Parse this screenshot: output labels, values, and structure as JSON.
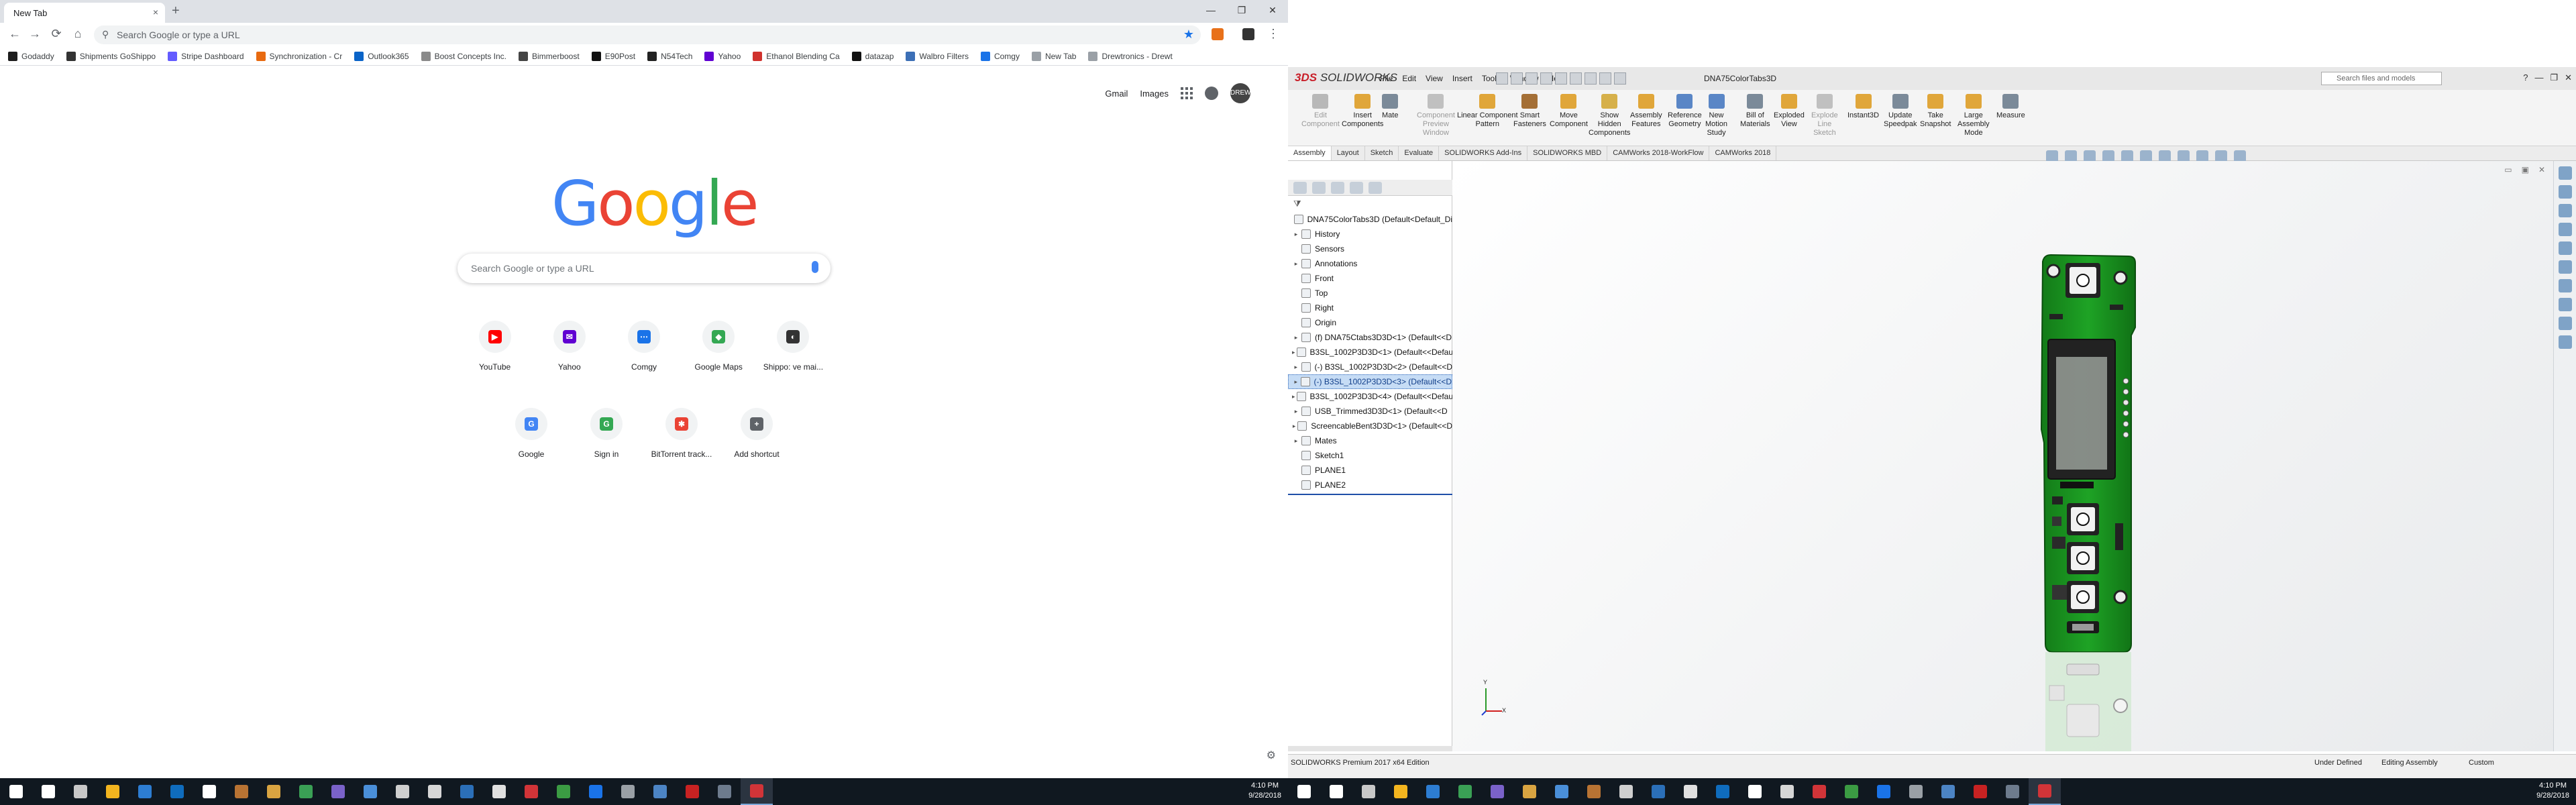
{
  "chrome": {
    "tab_title": "New Tab",
    "tab_close": "×",
    "new_tab": "+",
    "window_buttons": [
      "—",
      "❐",
      "✕"
    ],
    "nav": {
      "back": "←",
      "forward": "→",
      "reload": "⟳",
      "home": "⌂"
    },
    "omnibox_placeholder": "Search Google or type a URL",
    "bookmarks": [
      {
        "label": "Godaddy",
        "color": "#1d1d1d"
      },
      {
        "label": "Shipments GoShippo",
        "color": "#333333"
      },
      {
        "label": "Stripe Dashboard",
        "color": "#635bff"
      },
      {
        "label": "Synchronization - Cr",
        "color": "#e86a10"
      },
      {
        "label": "Outlook365",
        "color": "#0a64c8"
      },
      {
        "label": "Boost Concepts Inc.",
        "color": "#8a8a8a"
      },
      {
        "label": "Bimmerboost",
        "color": "#444444"
      },
      {
        "label": "E90Post",
        "color": "#111111"
      },
      {
        "label": "N54Tech",
        "color": "#222222"
      },
      {
        "label": "Yahoo",
        "color": "#6001d2"
      },
      {
        "label": "Ethanol Blending Ca",
        "color": "#d0312d"
      },
      {
        "label": "datazap",
        "color": "#111111"
      },
      {
        "label": "Walbro Filters",
        "color": "#3c6fb6"
      },
      {
        "label": "Comgy",
        "color": "#1a73e8"
      },
      {
        "label": "New Tab",
        "color": "#9aa0a6"
      },
      {
        "label": "Drewtronics - Drewt",
        "color": "#9aa0a6"
      }
    ],
    "header_links": {
      "gmail": "Gmail",
      "images": "Images",
      "avatar_text": "DREW"
    },
    "logo": "Google",
    "search_placeholder": "Search Google or type a URL",
    "shortcuts_row1": [
      {
        "label": "YouTube",
        "icon": "youtube-icon",
        "color": "#ff0000",
        "glyph": "▶"
      },
      {
        "label": "Yahoo",
        "icon": "yahoo-mail-icon",
        "color": "#6001d2",
        "glyph": "✉"
      },
      {
        "label": "Comgy",
        "icon": "comgy-icon",
        "color": "#1a73e8",
        "glyph": "⋯"
      },
      {
        "label": "Google Maps",
        "icon": "maps-icon",
        "color": "#34a853",
        "glyph": "◆"
      },
      {
        "label": "Shippo: ve mai...",
        "icon": "shippo-icon",
        "color": "#333333",
        "glyph": "◐"
      }
    ],
    "shortcuts_row2": [
      {
        "label": "Google",
        "icon": "google-icon",
        "color": "#4285f4",
        "glyph": "G"
      },
      {
        "label": "Sign in",
        "icon": "signin-icon",
        "color": "#34a853",
        "glyph": "G"
      },
      {
        "label": "BitTorrent track...",
        "icon": "bittorrent-icon",
        "color": "#ea4335",
        "glyph": "✱"
      },
      {
        "label": "Add shortcut",
        "icon": "add-icon",
        "color": "#5f6368",
        "glyph": "+"
      }
    ]
  },
  "taskbar_left": {
    "icon_colors": [
      "#ffffff",
      "#c8c8c8",
      "#f3b51f",
      "#2d7dd2",
      "#0f6cbd",
      "#ffffff",
      "#b87333",
      "#d9a441",
      "#3aa055",
      "#7a62c9",
      "#4a8fd9",
      "#cfcfcf",
      "#d6d6d6",
      "#2b6fb8",
      "#e0e0e0",
      "#d13438",
      "#3b9b43",
      "#1a73e8",
      "#9aa0a6",
      "#4c84c4",
      "#c82222",
      "#6d7b8d",
      "#d13438"
    ],
    "active_index": 22,
    "time": "4:10 PM",
    "date": "9/28/2018"
  },
  "solidworks": {
    "logo_ds": "3DS",
    "logo_text": "SOLIDWORKS",
    "menus": [
      "File",
      "Edit",
      "View",
      "Insert",
      "Tools",
      "Window",
      "Help"
    ],
    "doc_title": "DNA75ColorTabs3D",
    "search_placeholder": "Search files and models",
    "window_buttons": [
      "?",
      "—",
      "❐",
      "✕"
    ],
    "commands": [
      {
        "label": "Edit\nComponent",
        "enabled": false,
        "color": "#b8b8b8"
      },
      {
        "label": "Insert\nComponents",
        "enabled": true,
        "color": "#e0a63a"
      },
      {
        "label": "Mate",
        "enabled": true,
        "color": "#7b8a99"
      },
      {
        "label": "Component\nPreview\nWindow",
        "enabled": false,
        "color": "#c0c0c0"
      },
      {
        "label": "Linear Component\nPattern",
        "enabled": true,
        "color": "#e0a63a"
      },
      {
        "label": "Smart\nFasteners",
        "enabled": true,
        "color": "#a46f36"
      },
      {
        "label": "Move\nComponent",
        "enabled": true,
        "color": "#e0a63a"
      },
      {
        "label": "Show\nHidden\nComponents",
        "enabled": true,
        "color": "#d6b04a"
      },
      {
        "label": "Assembly\nFeatures",
        "enabled": true,
        "color": "#e0a63a"
      },
      {
        "label": "Reference\nGeometry",
        "enabled": true,
        "color": "#5a86c6"
      },
      {
        "label": "New\nMotion\nStudy",
        "enabled": true,
        "color": "#5a86c6"
      },
      {
        "label": "Bill of\nMaterials",
        "enabled": true,
        "color": "#7b8a99"
      },
      {
        "label": "Exploded\nView",
        "enabled": true,
        "color": "#e0a63a"
      },
      {
        "label": "Explode\nLine\nSketch",
        "enabled": false,
        "color": "#c0c0c0"
      },
      {
        "label": "Instant3D",
        "enabled": true,
        "color": "#e0a63a"
      },
      {
        "label": "Update\nSpeedpak",
        "enabled": true,
        "color": "#7b8a99"
      },
      {
        "label": "Take\nSnapshot",
        "enabled": true,
        "color": "#e0a63a"
      },
      {
        "label": "Large\nAssembly\nMode",
        "enabled": true,
        "color": "#e0a63a"
      },
      {
        "label": "Measure",
        "enabled": true,
        "color": "#7b8a99"
      }
    ],
    "cmd_tabs": [
      "Assembly",
      "Layout",
      "Sketch",
      "Evaluate",
      "SOLIDWORKS Add-Ins",
      "SOLIDWORKS MBD",
      "CAMWorks 2018-WorkFlow",
      "CAMWorks 2018"
    ],
    "tree": [
      {
        "label": "DNA75ColorTabs3D  (Default<Default_Di",
        "expander": "",
        "sel": false,
        "indent": 0
      },
      {
        "label": "History",
        "expander": "▸",
        "sel": false,
        "indent": 1
      },
      {
        "label": "Sensors",
        "expander": "",
        "sel": false,
        "indent": 1
      },
      {
        "label": "Annotations",
        "expander": "▸",
        "sel": false,
        "indent": 1
      },
      {
        "label": "Front",
        "expander": "",
        "sel": false,
        "indent": 1
      },
      {
        "label": "Top",
        "expander": "",
        "sel": false,
        "indent": 1
      },
      {
        "label": "Right",
        "expander": "",
        "sel": false,
        "indent": 1
      },
      {
        "label": "Origin",
        "expander": "",
        "sel": false,
        "indent": 1
      },
      {
        "label": "(f) DNA75Ctabs3D3D<1> (Default<<D",
        "expander": "▸",
        "sel": false,
        "indent": 1
      },
      {
        "label": "B3SL_1002P3D3D<1> (Default<<Defaul",
        "expander": "▸",
        "sel": false,
        "indent": 1
      },
      {
        "label": "(-) B3SL_1002P3D3D<2> (Default<<D",
        "expander": "▸",
        "sel": false,
        "indent": 1
      },
      {
        "label": "(-) B3SL_1002P3D3D<3> (Default<<D",
        "expander": "▸",
        "sel": true,
        "indent": 1
      },
      {
        "label": "B3SL_1002P3D3D<4> (Default<<Defaul",
        "expander": "▸",
        "sel": false,
        "indent": 1
      },
      {
        "label": "USB_Trimmed3D3D<1> (Default<<D",
        "expander": "▸",
        "sel": false,
        "indent": 1
      },
      {
        "label": "ScreencableBent3D3D<1> (Default<<D",
        "expander": "▸",
        "sel": false,
        "indent": 1
      },
      {
        "label": "Mates",
        "expander": "▸",
        "sel": false,
        "indent": 1
      },
      {
        "label": "Sketch1",
        "expander": "",
        "sel": false,
        "indent": 1
      },
      {
        "label": "PLANE1",
        "expander": "",
        "sel": false,
        "indent": 1
      },
      {
        "label": "PLANE2",
        "expander": "",
        "sel": false,
        "indent": 1
      }
    ],
    "status_left": "SOLIDWORKS Premium 2017 x64 Edition",
    "status_def": "Under Defined",
    "status_mode": "Editing Assembly",
    "status_units": "Custom",
    "triad_y": "Y",
    "triad_x": "X"
  },
  "taskbar_right": {
    "icon_colors": [
      "#ffffff",
      "#c8c8c8",
      "#f3b51f",
      "#2d7dd2",
      "#3aa055",
      "#7a62c9",
      "#d9a441",
      "#4a8fd9",
      "#b87333",
      "#cfcfcf",
      "#2b6fb8",
      "#e0e0e0",
      "#0f6cbd",
      "#ffffff",
      "#d6d6d6",
      "#d13438",
      "#3b9b43",
      "#1a73e8",
      "#9aa0a6",
      "#4c84c4",
      "#c82222",
      "#6d7b8d",
      "#d13438"
    ],
    "active_index": 22,
    "time": "4:10 PM",
    "date": "9/28/2018"
  }
}
